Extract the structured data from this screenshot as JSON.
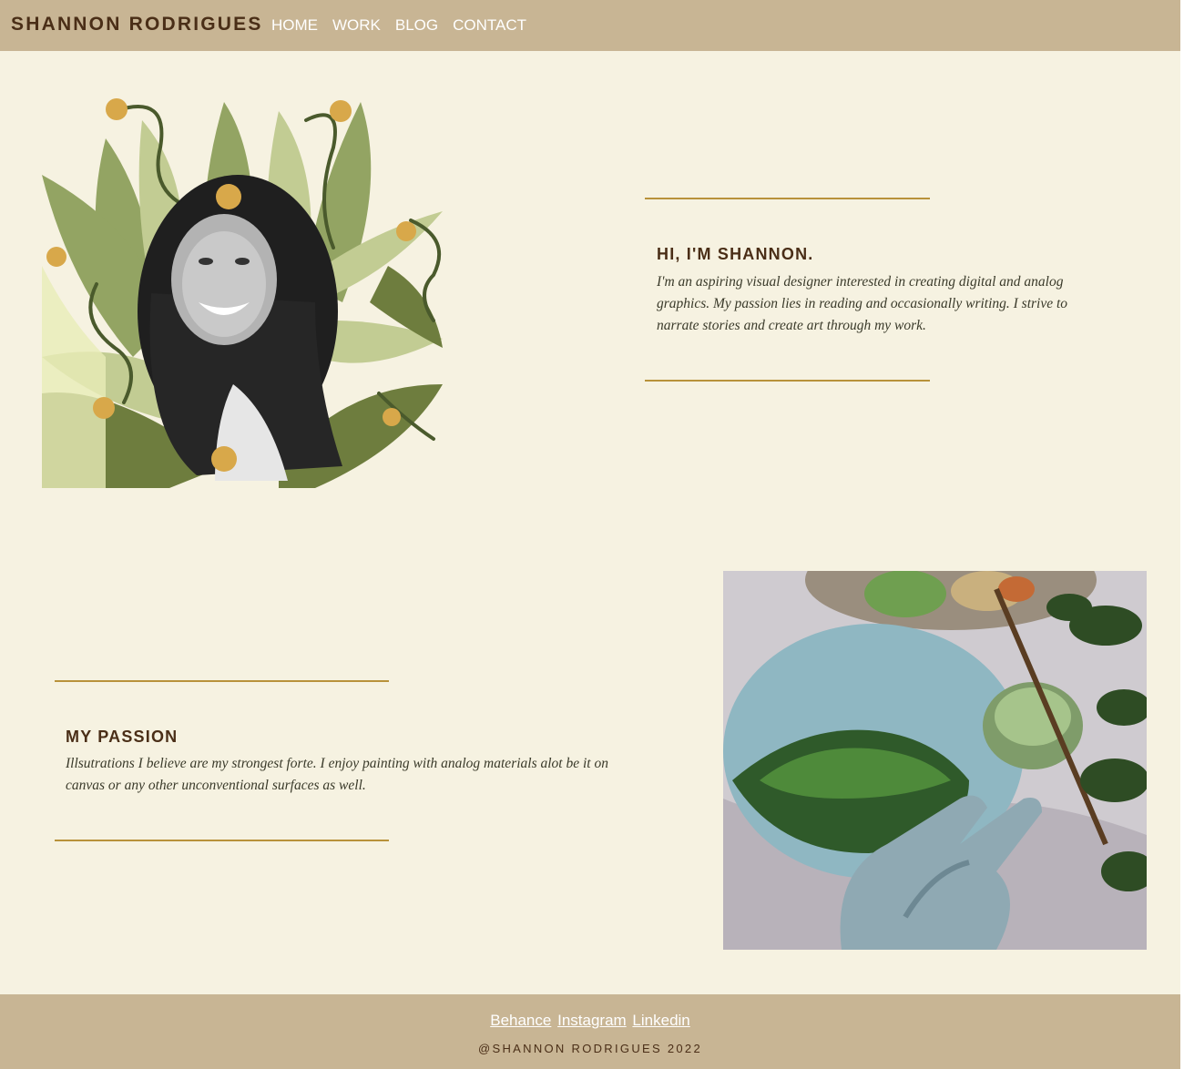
{
  "nav": {
    "brand": "SHANNON RODRIGUES",
    "items": [
      {
        "label": "HOME"
      },
      {
        "label": "WORK"
      },
      {
        "label": "BLOG"
      },
      {
        "label": "CONTACT"
      }
    ]
  },
  "intro": {
    "heading": "HI, I'M SHANNON.",
    "text": "I'm an aspiring visual designer interested in creating digital and analog graphics. My passion lies in reading and occasionally writing. I strive to narrate stories and create art through my work."
  },
  "passion": {
    "heading": "MY PASSION",
    "text": "Illsutrations I believe are my strongest forte. I enjoy painting with analog materials alot be it on canvas or any other unconventional surfaces as well."
  },
  "footer": {
    "links": [
      {
        "label": "Behance"
      },
      {
        "label": "Instagram"
      },
      {
        "label": "Linkedin"
      }
    ],
    "copyright": "@SHANNON RODRIGUES 2022"
  },
  "colors": {
    "nav_bg": "#c8b594",
    "page_bg": "#f6f2e1",
    "accent_rule": "#b8923a",
    "heading": "#4a2e17"
  },
  "icons": [
    "portrait-illustration",
    "painting-photo"
  ]
}
